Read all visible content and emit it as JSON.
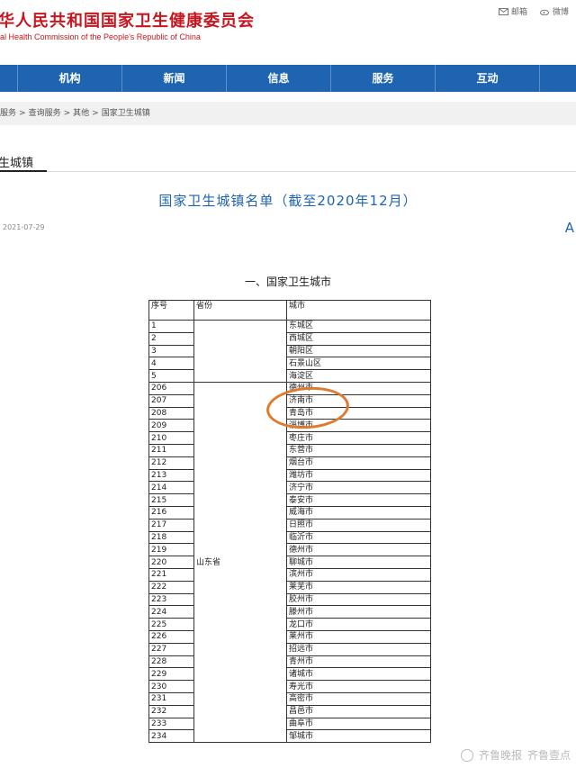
{
  "header": {
    "site_title": "华人民共和国国家卫生健康委员会",
    "site_subtitle": "al Health Commission of the People's Republic of China",
    "links": {
      "mail": "邮箱",
      "weibo": "微博"
    }
  },
  "nav": {
    "items": [
      "机构",
      "新闻",
      "信息",
      "服务",
      "互动"
    ]
  },
  "breadcrumb": [
    "服务",
    "查询服务",
    "其他",
    "国家卫生城镇"
  ],
  "section": {
    "title": "生城镇"
  },
  "article": {
    "title": "国家卫生城镇名单（截至2020年12月）",
    "date": "2021-07-29",
    "font_button": "A"
  },
  "document": {
    "heading": "一、国家卫生城市",
    "columns": [
      "序号",
      "省份",
      "城市"
    ],
    "beijing_rows": [
      {
        "no": "1",
        "city": "东城区"
      },
      {
        "no": "2",
        "city": "西城区"
      },
      {
        "no": "3",
        "city": "朝阳区"
      },
      {
        "no": "4",
        "city": "石景山区"
      },
      {
        "no": "5",
        "city": "海淀区"
      }
    ],
    "shandong_province": "山东省",
    "shandong_rows": [
      {
        "no": "206",
        "city": "德州市"
      },
      {
        "no": "207",
        "city": "济南市"
      },
      {
        "no": "208",
        "city": "青岛市"
      },
      {
        "no": "209",
        "city": "淄博市"
      },
      {
        "no": "210",
        "city": "枣庄市"
      },
      {
        "no": "211",
        "city": "东营市"
      },
      {
        "no": "212",
        "city": "烟台市"
      },
      {
        "no": "213",
        "city": "潍坊市"
      },
      {
        "no": "214",
        "city": "济宁市"
      },
      {
        "no": "215",
        "city": "泰安市"
      },
      {
        "no": "216",
        "city": "威海市"
      },
      {
        "no": "217",
        "city": "日照市"
      },
      {
        "no": "218",
        "city": "临沂市"
      },
      {
        "no": "219",
        "city": "德州市"
      },
      {
        "no": "220",
        "city": "聊城市"
      },
      {
        "no": "221",
        "city": "滨州市"
      },
      {
        "no": "222",
        "city": "莱芜市"
      },
      {
        "no": "223",
        "city": "胶州市"
      },
      {
        "no": "224",
        "city": "滕州市"
      },
      {
        "no": "225",
        "city": "龙口市"
      },
      {
        "no": "226",
        "city": "莱州市"
      },
      {
        "no": "227",
        "city": "招远市"
      },
      {
        "no": "228",
        "city": "青州市"
      },
      {
        "no": "229",
        "city": "诸城市"
      },
      {
        "no": "230",
        "city": "寿光市"
      },
      {
        "no": "231",
        "city": "高密市"
      },
      {
        "no": "232",
        "city": "昌邑市"
      },
      {
        "no": "233",
        "city": "曲阜市"
      },
      {
        "no": "234",
        "city": "邹城市"
      }
    ]
  },
  "watermark": {
    "left": "齐鲁晚报",
    "right": "齐鲁壹点"
  },
  "colors": {
    "brand_red": "#c7161e",
    "nav_blue": "#1e64b0",
    "highlight_orange": "#e07a2e"
  }
}
